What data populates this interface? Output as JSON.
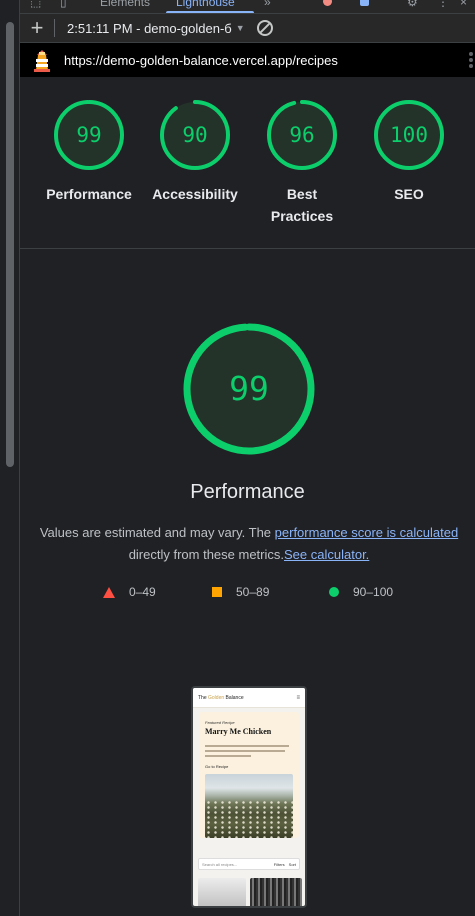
{
  "devtools": {
    "tabs": [
      "Elements",
      "Lighthouse"
    ],
    "active_tab": "Lighthouse",
    "toolbar": {
      "new_report_label": "+",
      "report_select": "2:51:11 PM - demo-golden-б",
      "clear_icon": "block-icon"
    }
  },
  "url": "https://demo-golden-balance.vercel.app/recipes",
  "scores": [
    {
      "label": "Performance",
      "value": "99",
      "pct": 0.99
    },
    {
      "label": "Accessibility",
      "value": "90",
      "pct": 0.9
    },
    {
      "label": "Best Practices",
      "value": "96",
      "pct": 0.96
    },
    {
      "label": "SEO",
      "value": "100",
      "pct": 1.0
    }
  ],
  "performance": {
    "value": "99",
    "pct": 0.99,
    "title": "Performance",
    "desc_pre": "Values are estimated and may vary. The ",
    "desc_link": "performance score is calculated",
    "desc_mid": " directly from these metrics.",
    "desc_link2": "See calculator."
  },
  "legend": [
    {
      "shape": "triangle",
      "range": "0–49",
      "color": "#ff4e42"
    },
    {
      "shape": "square",
      "range": "50–89",
      "color": "#ffa400"
    },
    {
      "shape": "circle",
      "range": "90–100",
      "color": "#0cce6b"
    }
  ],
  "colors": {
    "pass": "#0cce6b",
    "link": "#8ab4f8",
    "background": "#202124"
  },
  "screenshot": {
    "brand_pre": "The ",
    "brand_gold": "Golden",
    "brand_post": " Balance",
    "featured": "Featured Recipe",
    "title": "Marry Me Chicken",
    "button": "Go to Recipe",
    "search_placeholder": "Search all recipes...",
    "filters": "Filters",
    "sort": "Sort"
  }
}
